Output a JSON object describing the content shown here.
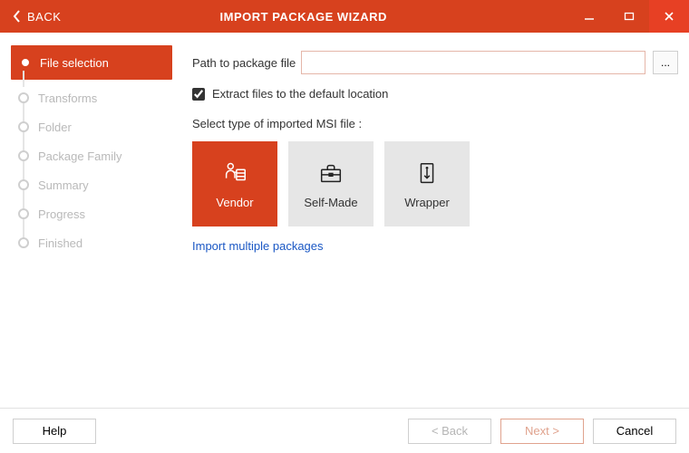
{
  "window": {
    "back_label": "BACK",
    "title": "IMPORT PACKAGE WIZARD"
  },
  "steps": [
    {
      "label": "File selection",
      "active": true
    },
    {
      "label": "Transforms",
      "active": false
    },
    {
      "label": "Folder",
      "active": false
    },
    {
      "label": "Package Family",
      "active": false
    },
    {
      "label": "Summary",
      "active": false
    },
    {
      "label": "Progress",
      "active": false
    },
    {
      "label": "Finished",
      "active": false
    }
  ],
  "form": {
    "path_label": "Path to package file",
    "path_value": "",
    "path_placeholder": "",
    "browse_label": "...",
    "extract_checked": true,
    "extract_label": "Extract files to the default location",
    "select_type_label": "Select type of imported MSI file :",
    "tiles": {
      "vendor": "Vendor",
      "selfmade": "Self-Made",
      "wrapper": "Wrapper"
    },
    "import_multiple": "Import multiple packages"
  },
  "footer": {
    "help": "Help",
    "back": "< Back",
    "next": "Next >",
    "cancel": "Cancel"
  },
  "colors": {
    "accent": "#d7411e"
  }
}
